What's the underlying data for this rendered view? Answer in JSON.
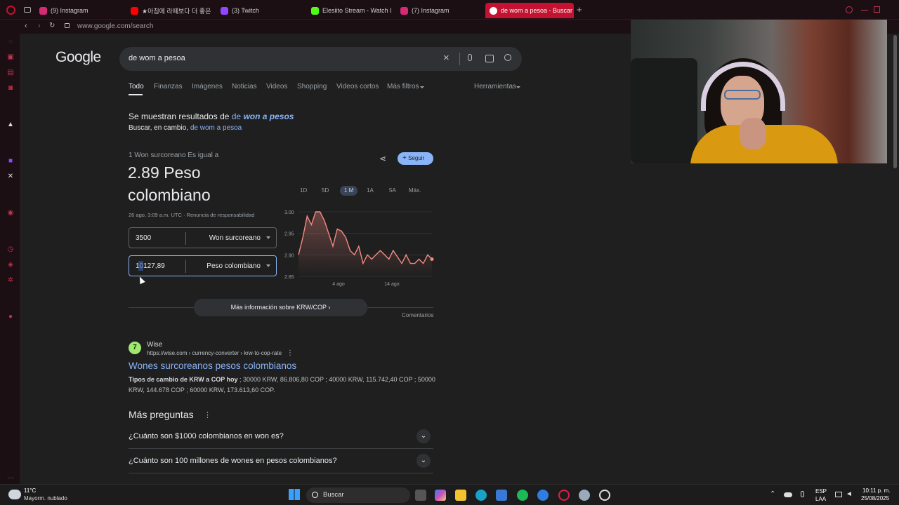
{
  "browser": {
    "tabs": [
      {
        "label": "(9) Instagram",
        "color": "#d62976"
      },
      {
        "label": "★아침에 라떼보다 더 좋은",
        "color": "#ff0000"
      },
      {
        "label": "(3) Twitch",
        "color": "#9146ff"
      },
      {
        "label": "Elesiito Stream - Watch L",
        "color": "#53fc18"
      },
      {
        "label": "(7) Instagram",
        "color": "#d62976"
      },
      {
        "label": "de wom a pesoa - Buscar",
        "color": "#ffffff"
      }
    ],
    "url": "www.google.com/search"
  },
  "google": {
    "logo": "Google",
    "query": "de wom a pesoa",
    "filters": [
      "Todo",
      "Finanzas",
      "Imágenes",
      "Noticias",
      "Videos",
      "Shopping",
      "Videos cortos",
      "Más filtros"
    ],
    "tools": "Herramientas",
    "correction": {
      "prefix": "Se muestran resultados de ",
      "corrected_a": "de ",
      "corrected_b": "won a pesos",
      "instead_prefix": "Buscar, en cambio, ",
      "instead_link": "de wom a pesoa"
    },
    "converter": {
      "equals": "1 Won surcoreano Es igual a",
      "result_line1": "2.89 Peso",
      "result_line2": "colombiano",
      "timestamp": "26 ago, 3:09 a.m. UTC · Renuncia de responsabilidad",
      "follow": "Seguir",
      "from_value": "3500",
      "from_currency": "Won surcoreano",
      "to_value": "10127,89",
      "to_currency": "Peso colombiano",
      "more_info": "Más información sobre KRW/COP",
      "feedback": "Comentarios"
    },
    "result": {
      "site": "Wise",
      "breadcrumb": "https://wise.com › currency-converter › krw-to-cop-rate",
      "title": "Wones surcoreanos pesos colombianos",
      "snippet_bold": "Tipos de cambio de KRW a COP hoy",
      "snippet": " ; 30000 KRW, 86.806,80 COP ; 40000 KRW, 115.742,40 COP ; 50000 KRW, 144.678 COP ; 60000 KRW, 173.613,60 COP."
    },
    "paa_title": "Más preguntas",
    "questions": [
      "¿Cuánto son $1000 colombianos en won es?",
      "¿Cuánto son 100 millones de wones en pesos colombianos?"
    ]
  },
  "chart_data": {
    "type": "line",
    "ranges": [
      "1D",
      "5D",
      "1 M",
      "1A",
      "5A",
      "Máx."
    ],
    "selected_range": "1 M",
    "yticks": [
      "3.00",
      "2.95",
      "2.90",
      "2.85"
    ],
    "xticks": [
      "4 ago",
      "14 ago"
    ],
    "ylim": [
      2.85,
      3.0
    ],
    "values": [
      2.9,
      2.94,
      2.99,
      2.97,
      3.0,
      3.0,
      2.98,
      2.95,
      2.92,
      2.96,
      2.955,
      2.94,
      2.91,
      2.9,
      2.92,
      2.88,
      2.9,
      2.89,
      2.9,
      2.91,
      2.9,
      2.89,
      2.91,
      2.895,
      2.88,
      2.9,
      2.88,
      2.88,
      2.89,
      2.88,
      2.9,
      2.89
    ],
    "line_color": "#f28b82"
  },
  "taskbar": {
    "weather_temp": "11°C",
    "weather_desc": "Mayorm. nublado",
    "search": "Buscar",
    "lang1": "ESP",
    "lang2": "LAA",
    "time": "10:11 p. m.",
    "date": "25/08/2025"
  }
}
